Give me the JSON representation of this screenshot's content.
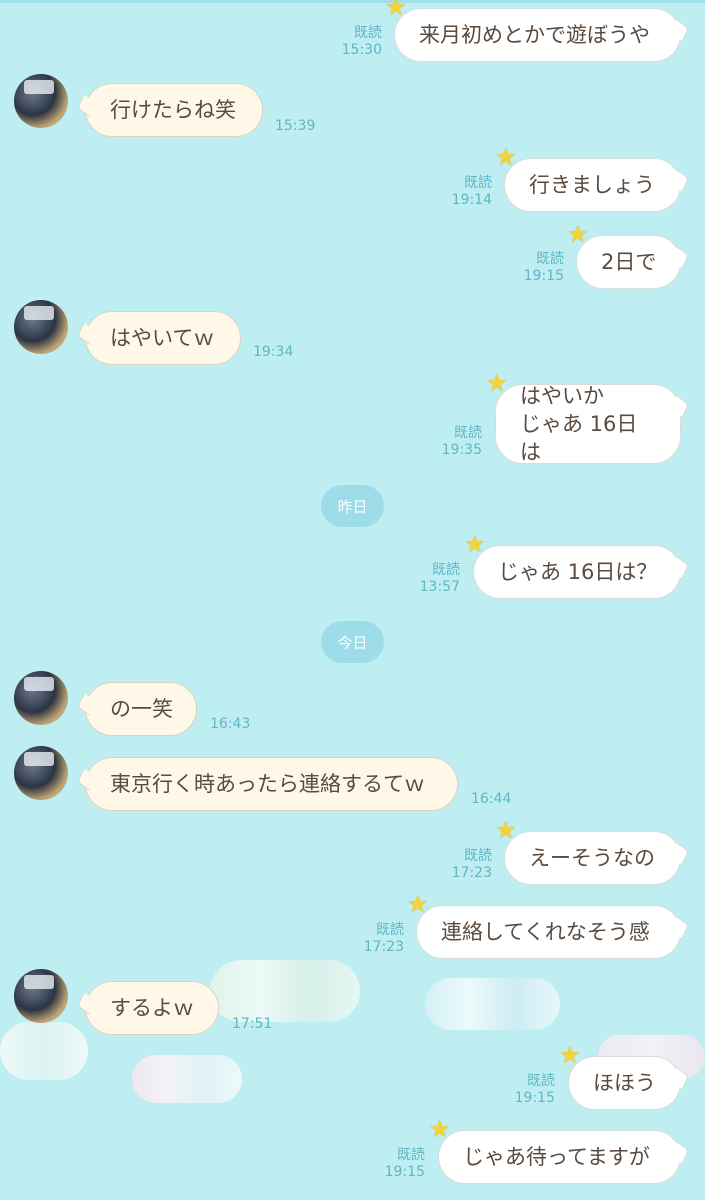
{
  "messages": {
    "m1": {
      "text": "来月初めとかで遊ぼうや",
      "read": "既読",
      "time": "15:30"
    },
    "m2": {
      "text": "行けたらね笑",
      "time": "15:39"
    },
    "m3": {
      "text": "行きましょう",
      "read": "既読",
      "time": "19:14"
    },
    "m4": {
      "text": "2日で",
      "read": "既読",
      "time": "19:15"
    },
    "m5": {
      "text": "はやいてｗ",
      "time": "19:34"
    },
    "m6": {
      "line1": "はやいか",
      "line2": "じゃあ 16日は",
      "read": "既読",
      "time": "19:35"
    },
    "m7": {
      "text": "じゃあ 16日は？",
      "read": "既読",
      "time": "13:57"
    },
    "m8": {
      "text": "の一笑",
      "time": "16:43"
    },
    "m9": {
      "text": "東京行く時あったら連絡するてｗ",
      "time": "16:44"
    },
    "m10": {
      "text": "えーそうなの",
      "read": "既読",
      "time": "17:23"
    },
    "m11": {
      "text": "連絡してくれなそう感",
      "read": "既読",
      "time": "17:23"
    },
    "m12": {
      "text": "するよｗ",
      "time": "17:51"
    },
    "m13": {
      "text": "ほほう",
      "read": "既読",
      "time": "19:15"
    },
    "m14": {
      "text": "じゃあ待ってますが",
      "read": "既読",
      "time": "19:15"
    }
  },
  "dividers": {
    "yesterday": "昨日",
    "today": "今日"
  },
  "icons": {
    "star": "star-icon",
    "avatar": "user-avatar"
  },
  "colors": {
    "background": "#bfeef2",
    "incoming_bubble": "#fff8e8",
    "outgoing_bubble": "#ffffff",
    "meta_text": "#5fb6c4",
    "star": "#f5d23a"
  }
}
